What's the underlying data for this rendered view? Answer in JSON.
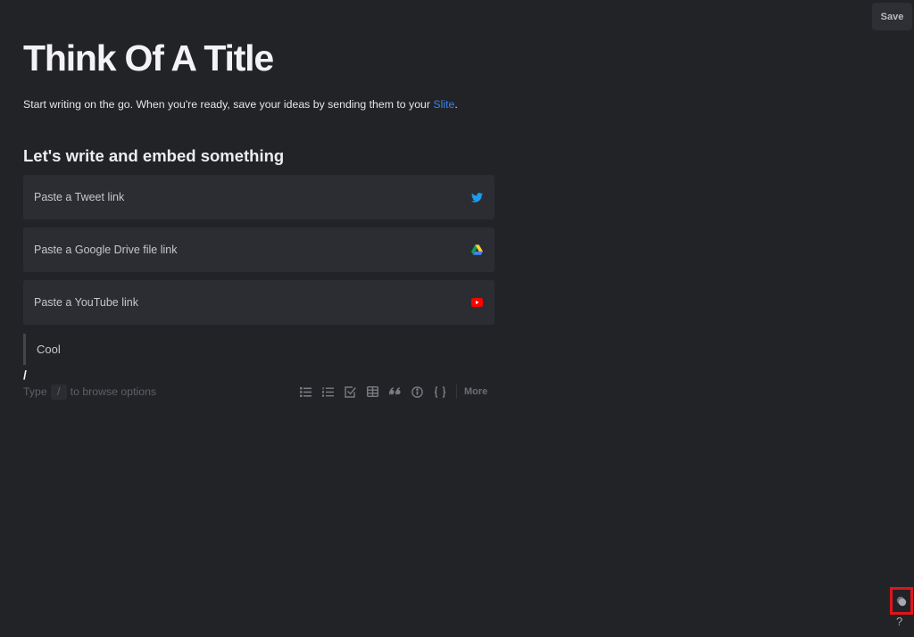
{
  "header": {
    "save_label": "Save"
  },
  "document": {
    "title": "Think Of A Title",
    "intro_text": "Start writing on the go. When you're ready, save your ideas by sending them to your ",
    "intro_link": "Slite",
    "intro_end": ".",
    "section_heading": "Let's write and embed something",
    "embeds": [
      {
        "label": "Paste a Tweet link",
        "icon": "twitter-icon",
        "color": "#1d9bf0"
      },
      {
        "label": "Paste a Google Drive file link",
        "icon": "google-drive-icon",
        "color": "#1fa463"
      },
      {
        "label": "Paste a YouTube link",
        "icon": "youtube-icon",
        "color": "#ff0000"
      }
    ],
    "quote_text": "Cool",
    "current_line": "/"
  },
  "hint": {
    "prefix": "Type",
    "key": "/",
    "suffix": "to browse options"
  },
  "toolbar": {
    "items": [
      {
        "name": "bulleted-list",
        "icon": "bulleted-list-icon"
      },
      {
        "name": "numbered-list",
        "icon": "numbered-list-icon"
      },
      {
        "name": "checklist",
        "icon": "checkbox-icon"
      },
      {
        "name": "table",
        "icon": "table-icon"
      },
      {
        "name": "quote",
        "icon": "quote-icon"
      },
      {
        "name": "callout",
        "icon": "info-icon"
      },
      {
        "name": "code",
        "icon": "code-braces-icon"
      }
    ],
    "more_label": "More"
  },
  "corner": {
    "help_label": "?",
    "theme_toggle_icon": "theme-toggle-icon"
  },
  "colors": {
    "background": "#222327",
    "card": "#2c2d32",
    "link": "#3d82e6",
    "highlight_outline": "#e0141b"
  }
}
